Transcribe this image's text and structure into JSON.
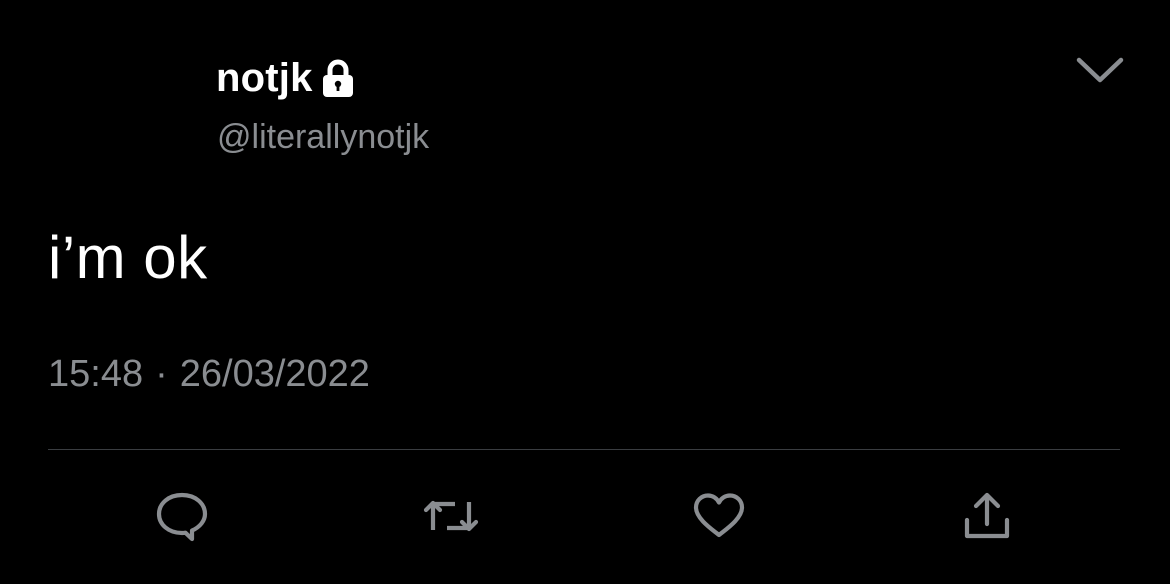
{
  "user": {
    "display_name": "notjk",
    "handle": "@literallynotjk",
    "protected_icon": "lock-icon"
  },
  "tweet": {
    "text": "i’m ok",
    "time": "15:48",
    "separator": "·",
    "date": "26/03/2022"
  },
  "actions": {
    "reply_icon": "reply-icon",
    "retweet_icon": "retweet-icon",
    "like_icon": "heart-icon",
    "share_icon": "share-icon",
    "more_icon": "chevron-down-icon"
  },
  "colors": {
    "background": "#000000",
    "primary_text": "#ffffff",
    "secondary_text": "#8a8d91",
    "icon": "#8a8d91",
    "divider": "#3a3d41"
  }
}
